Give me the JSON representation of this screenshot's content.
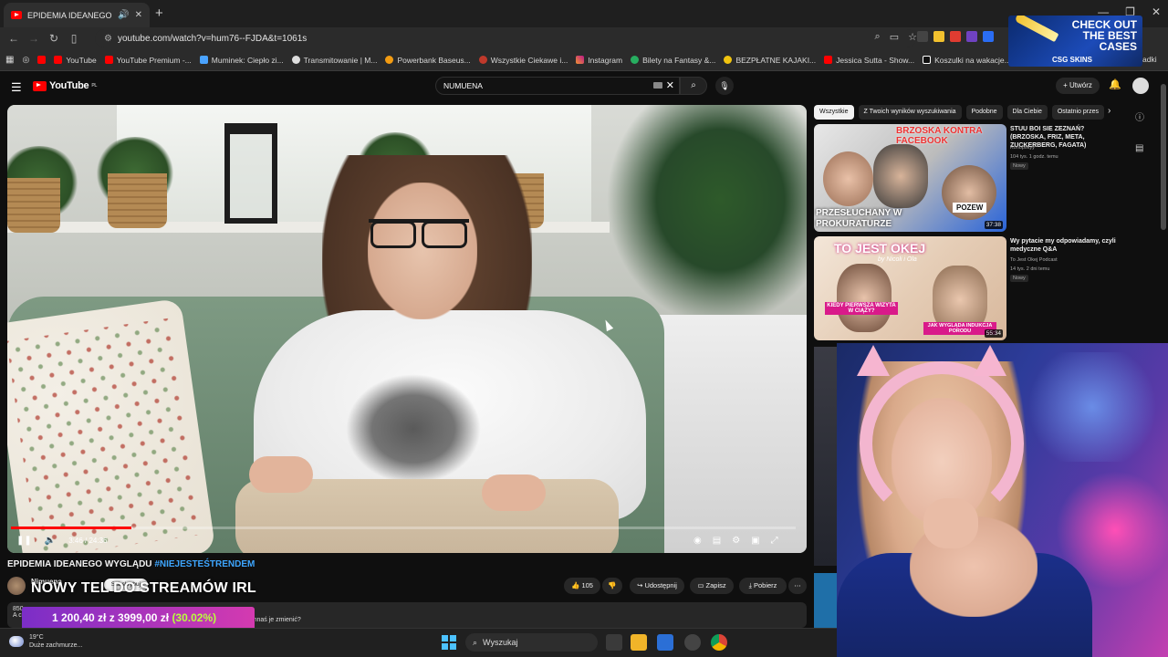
{
  "browser": {
    "tab_title": "EPIDEMIA IDEANEGO WYGLĄDU",
    "url": "youtube.com/watch?v=hum76--FJDA&t=1061s",
    "bookmarks": [
      "YouTube",
      "YouTube Premium -...",
      "Muminek: Ciepło zi...",
      "Transmitowanie | M...",
      "Powerbank Baseus...",
      "Wszystkie Ciekawe i...",
      "Instagram",
      "Bilety na Fantasy &...",
      "BEZPŁATNE KAJAKI...",
      "Jessica Sutta - Show...",
      "Koszulki na wakacje...",
      "adki"
    ]
  },
  "ad": {
    "headline": "CHECK OUT THE BEST CASES",
    "brand": "CSG SKINS"
  },
  "youtube": {
    "logo": "YouTube",
    "region": "PL",
    "search_value": "NUMUENA",
    "create_label": "Utwórz"
  },
  "player": {
    "time": "3:46 / 24:36",
    "progress": 0.153
  },
  "video": {
    "title": "EPIDEMIA IDEANEGO WYGLĄDU",
    "hashtag": "#NIEJESTEŚTRENDEM",
    "channel": "Nimuena",
    "subscribe": "Subskrybuj",
    "likes": "105",
    "share": "Udostępnij",
    "save": "Zapisz",
    "download": "Pobierz",
    "desc_views": "850",
    "desc_text": "Ci, gdyby internet nie powiedział Ci, że powinnaś je zmienić?",
    "desc_prefix": "A c"
  },
  "stream_overlay": {
    "title": "NOWY TEL DO STREAMÓW IRL",
    "donation": "1 200,40 zł z 3999,00 zł",
    "percent": "(30.02%)"
  },
  "sidebar": {
    "chips": [
      "Wszystkie",
      "Z Twoich wyników wyszukiwania",
      "Podobne",
      "Dla Ciebie",
      "Ostatnio przes"
    ],
    "recs": [
      {
        "title": "STUU BOI SIE ZEZNAŃ? (BRZOSKA, FRIZ, META, ZUCKERBERG, FAGATA)",
        "channel": "Konopskyy",
        "meta": "104 tys. 1 godz. temu",
        "badge": "Nowy",
        "duration": "37:38",
        "thumb_text1": "BRZOSKA KONTRA FACEBOOK",
        "thumb_text2": "PRZESŁUCHANY W PROKURATURZE",
        "thumb_text3": "POZEW"
      },
      {
        "title": "Wy pytacie my odpowiadamy, czyli medyczne Q&A",
        "channel": "To Jest Okej Podcast",
        "meta": "14 tys. 2 dni temu",
        "badge": "Nowy",
        "duration": "55:34",
        "thumb_text1": "TO JEST OKEJ",
        "thumb_text2": "by Nicoli i Ola",
        "thumb_text3": "KIEDY PIERWSZA WIZYTA W CIĄŻY?",
        "thumb_text4": "JAK WYGLĄDA INDUKCJA PORODU"
      }
    ]
  },
  "taskbar": {
    "temp": "19°C",
    "weather": "Duże zachmurze...",
    "search": "Wyszukaj"
  },
  "colors": {
    "accent": "#ff0000",
    "link": "#3ea6ff",
    "donation_pct": "#b9ff3c"
  }
}
